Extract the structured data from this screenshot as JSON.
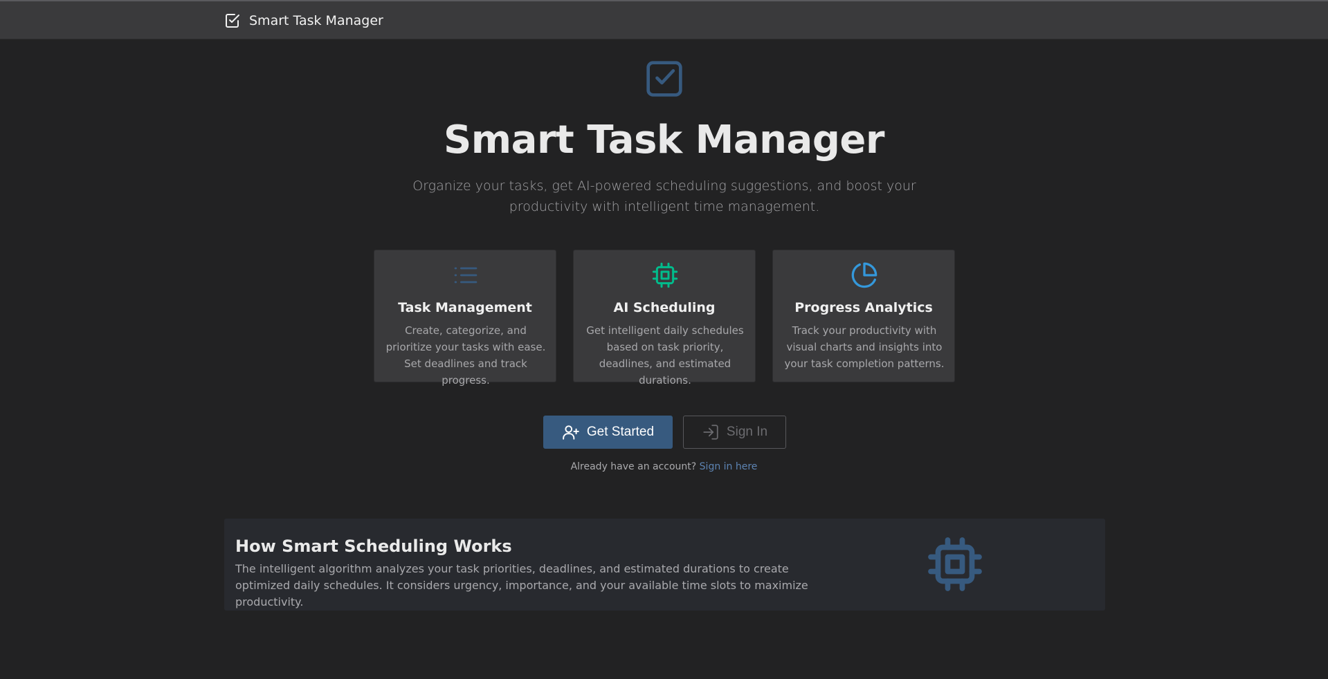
{
  "navbar": {
    "brand": "Smart Task Manager",
    "brand_icon": "check-square-icon"
  },
  "hero": {
    "icon": "check-square-icon",
    "title": "Smart Task Manager",
    "subtitle": "Organize your tasks, get AI-powered scheduling suggestions, and boost your productivity with intelligent time management."
  },
  "features": [
    {
      "icon": "list-icon",
      "color": "#375a7f",
      "title": "Task Management",
      "text": "Create, categorize, and prioritize your tasks with ease. Set deadlines and track progress."
    },
    {
      "icon": "cpu-icon",
      "color": "#00bc8c",
      "title": "AI Scheduling",
      "text": "Get intelligent daily schedules based on task priority, deadlines, and estimated durations."
    },
    {
      "icon": "pie-chart-icon",
      "color": "#3498db",
      "title": "Progress Analytics",
      "text": "Track your productivity with visual charts and insights into your task completion patterns."
    }
  ],
  "actions": {
    "get_started": "Get Started",
    "sign_in": "Sign In",
    "already_text": "Already have an account?",
    "sign_in_link": "Sign in here"
  },
  "how_it_works": {
    "title": "How Smart Scheduling Works",
    "text": "The intelligent algorithm analyzes your task priorities, deadlines, and estimated durations to create optimized daily schedules. It considers urgency, importance, and your available time slots to maximize productivity.",
    "icon": "cpu-icon"
  },
  "colors": {
    "primary": "#375a7f",
    "success": "#00bc8c",
    "info": "#3498db",
    "background": "#222223"
  }
}
